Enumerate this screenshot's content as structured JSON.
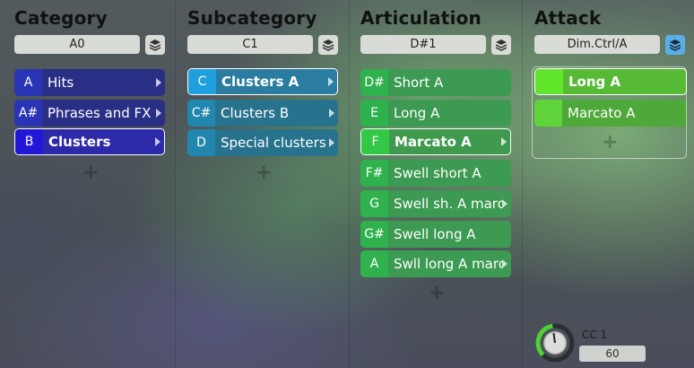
{
  "colors": {
    "category_accent": "#2217d6",
    "subcategory_accent": "#1ea0de",
    "articulation_accent": "#33c845",
    "attack_accent": "#60e52a",
    "stack_active": "#5aaee6"
  },
  "category": {
    "title": "Category",
    "field": "A0",
    "items": [
      {
        "key": "A",
        "label": "Hits"
      },
      {
        "key": "A#",
        "label": "Phrases and FX"
      },
      {
        "key": "B",
        "label": "Clusters"
      }
    ],
    "add_icon": "+"
  },
  "subcategory": {
    "title": "Subcategory",
    "field": "C1",
    "items": [
      {
        "key": "C",
        "label": "Clusters A"
      },
      {
        "key": "C#",
        "label": "Clusters B"
      },
      {
        "key": "D",
        "label": "Special clusters"
      }
    ],
    "add_icon": "+"
  },
  "articulation": {
    "title": "Articulation",
    "field": "D#1",
    "items": [
      {
        "key": "D#",
        "label": "Short A"
      },
      {
        "key": "E",
        "label": "Long A"
      },
      {
        "key": "F",
        "label": "Marcato A"
      },
      {
        "key": "F#",
        "label": "Swell short A"
      },
      {
        "key": "G",
        "label": "Swell sh. A marc."
      },
      {
        "key": "G#",
        "label": "Swell long A"
      },
      {
        "key": "A",
        "label": "Swll long A marc"
      }
    ],
    "add_icon": "+"
  },
  "attack": {
    "title": "Attack",
    "field": "Dim.Ctrl/A",
    "items": [
      {
        "key": "",
        "label": "Long A"
      },
      {
        "key": "",
        "label": "Marcato A"
      }
    ],
    "add_icon": "+"
  },
  "cc": {
    "label": "CC 1",
    "value": "60",
    "level": 0.47
  }
}
